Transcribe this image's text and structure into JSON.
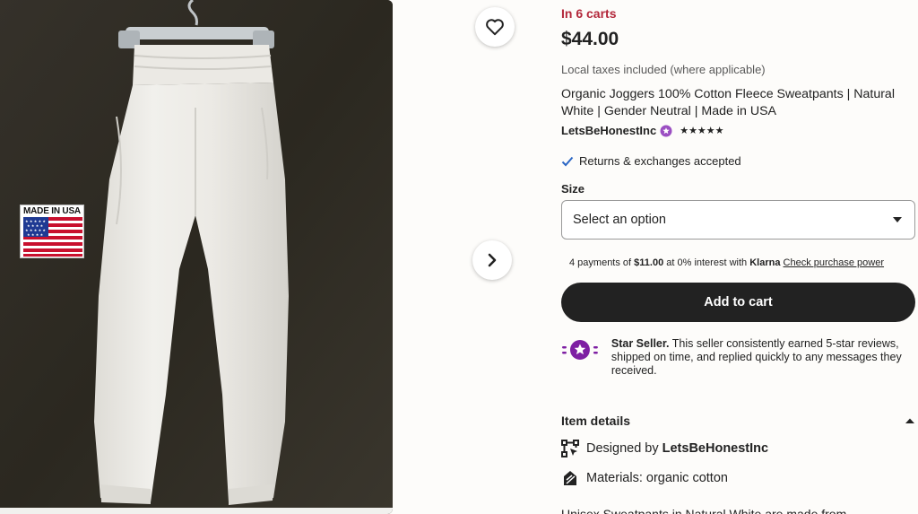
{
  "product": {
    "badge_text": "MADE IN USA"
  },
  "listing": {
    "in_carts": "In 6 carts",
    "price": "$44.00",
    "taxes_note": "Local taxes included (where applicable)",
    "title": "Organic Joggers 100% Cotton Fleece Sweatpants | Natural White | Gender Neutral | Made in USA",
    "shop_name": "LetsBeHonestInc",
    "rating_stars": "★★★★★",
    "rating_value": 5,
    "returns": "Returns & exchanges accepted",
    "size_label": "Size",
    "size_select_placeholder": "Select an option",
    "klarna_prefix": "4 payments of ",
    "klarna_amount": "$11.00",
    "klarna_middle": " at 0% interest with ",
    "klarna_brand": "Klarna",
    "klarna_link": "Check purchase power",
    "add_to_cart": "Add to cart",
    "star_seller_title": "Star Seller.",
    "star_seller_text": " This seller consistently earned 5-star reviews, shipped on time, and replied quickly to any messages they received."
  },
  "item_details": {
    "title": "Item details",
    "designed_prefix": "Designed by ",
    "designed_by": "LetsBeHonestInc",
    "materials": "Materials: organic cotton",
    "description_cutoff": "Unisex Sweatpants in Natural White are made from"
  },
  "colors": {
    "accent_red": "#b3283b",
    "button_dark": "#222222",
    "star_seller_purple": "#7e1fa3",
    "check_blue": "#2a66c4"
  },
  "icons": [
    "heart-icon",
    "chevron-right-icon",
    "star-seller-badge-icon",
    "check-icon",
    "caret-down-icon",
    "chevron-up-icon",
    "designed-by-icon",
    "materials-icon"
  ]
}
